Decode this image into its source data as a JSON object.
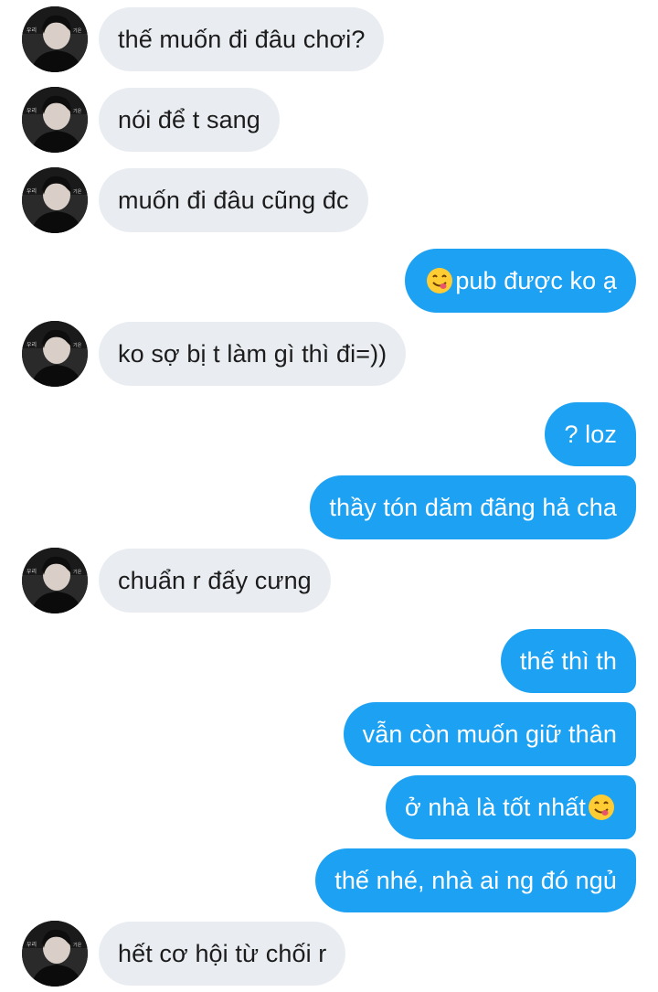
{
  "conversation": {
    "messages": [
      {
        "side": "in",
        "text": "thế muốn đi đâu chơi?"
      },
      {
        "side": "in",
        "text": "nói để t sang"
      },
      {
        "side": "in",
        "text": "muốn đi đâu cũng đc"
      },
      {
        "side": "out",
        "text": "pub được ko ạ",
        "emoji": "yum-face-emoji",
        "emoji_position": "start"
      },
      {
        "side": "in",
        "text": "ko sợ bị t làm gì thì đi=))"
      },
      {
        "side": "out",
        "text": "? loz"
      },
      {
        "side": "out",
        "text": "thầy tón dăm đãng hả cha"
      },
      {
        "side": "in",
        "text": "chuẩn r đấy cưng"
      },
      {
        "side": "out",
        "text": "thế thì th"
      },
      {
        "side": "out",
        "text": "vẫn còn muốn giữ thân"
      },
      {
        "side": "out",
        "text": "ở nhà là tốt nhất",
        "emoji": "yum-face-emoji",
        "emoji_position": "end"
      },
      {
        "side": "out",
        "text": "thế nhé, nhà ai ng đó ngủ"
      },
      {
        "side": "in",
        "text": "hết cơ hội từ chối r"
      }
    ]
  },
  "colors": {
    "incoming_bubble": "#e9edf1",
    "incoming_text": "#1c1c1c",
    "outgoing_bubble": "#1da1f2",
    "outgoing_text": "#ffffff"
  }
}
